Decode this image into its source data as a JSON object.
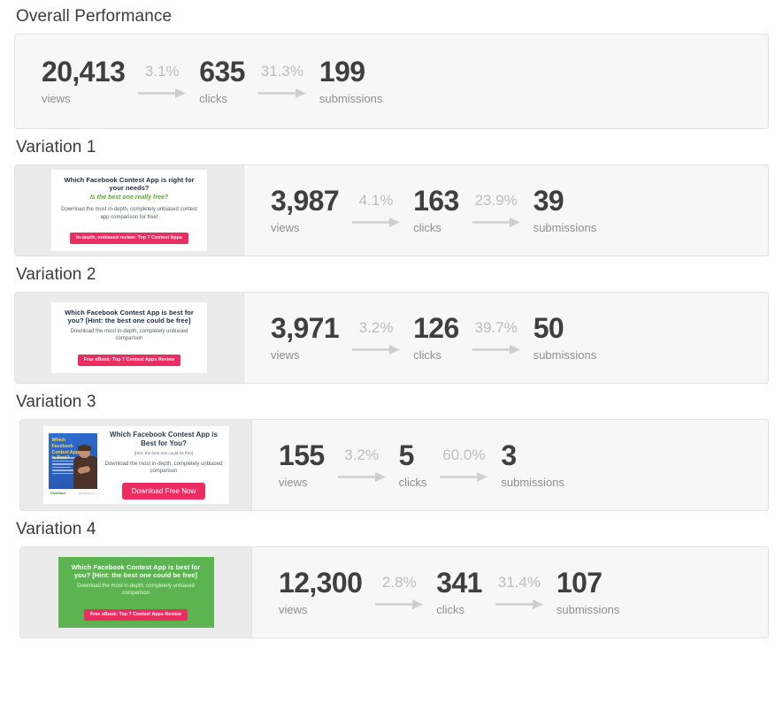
{
  "accent": {
    "cta_pink": "#ec2d62",
    "green_bg": "#5cb450",
    "value_gray": "#3f3f3f",
    "muted_gray": "#bdbdbd"
  },
  "overall": {
    "title": "Overall Performance",
    "views": {
      "value": "20,413",
      "label": "views"
    },
    "rate_views_clicks": "3.1%",
    "clicks": {
      "value": "635",
      "label": "clicks"
    },
    "rate_clicks_subs": "31.3%",
    "submissions": {
      "value": "199",
      "label": "submissions"
    }
  },
  "variations": [
    {
      "title": "Variation 1",
      "views": {
        "value": "3,987",
        "label": "views"
      },
      "rate_views_clicks": "4.1%",
      "clicks": {
        "value": "163",
        "label": "clicks"
      },
      "rate_clicks_subs": "23.9%",
      "submissions": {
        "value": "39",
        "label": "submissions"
      },
      "ad": {
        "style": "white",
        "headline": "Which Facebook Contest App is right for your needs?",
        "subhead": "Is the best one really free?",
        "body": "Download the most in-depth, completely unbiased contest app comparison for free!",
        "button": "In-depth, unbiased review: Top 7 Contest Apps"
      }
    },
    {
      "title": "Variation 2",
      "views": {
        "value": "3,971",
        "label": "views"
      },
      "rate_views_clicks": "3.2%",
      "clicks": {
        "value": "126",
        "label": "clicks"
      },
      "rate_clicks_subs": "39.7%",
      "submissions": {
        "value": "50",
        "label": "submissions"
      },
      "ad": {
        "style": "white",
        "headline": "Which Facebook Contest App is best for you?  [Hint: the best one could be free]",
        "body": "Download the most in-depth, completely unbiased comparison",
        "button": "Free eBook: Top 7 Contest Apps Review"
      }
    },
    {
      "title": "Variation 3",
      "views": {
        "value": "155",
        "label": "views"
      },
      "rate_views_clicks": "3.2%",
      "clicks": {
        "value": "5",
        "label": "clicks"
      },
      "rate_clicks_subs": "60.0%",
      "submissions": {
        "value": "3",
        "label": "submissions"
      },
      "ad": {
        "style": "ebook",
        "cover_title": "Which Facebook Contest App is Best?",
        "cover_logo": "ShortStack",
        "cover_url": "shortstack.com",
        "headline": "Which Facebook Contest App is Best for You?",
        "hint": "[Hint: the best one could be free]",
        "body": "Download the most in-depth, completely unbiased comparison",
        "button": "Download Free Now"
      }
    },
    {
      "title": "Variation 4",
      "views": {
        "value": "12,300",
        "label": "views"
      },
      "rate_views_clicks": "2.8%",
      "clicks": {
        "value": "341",
        "label": "clicks"
      },
      "rate_clicks_subs": "31.4%",
      "submissions": {
        "value": "107",
        "label": "submissions"
      },
      "ad": {
        "style": "green",
        "headline": "Which Facebook Contest App is best for you?  [Hint: the best one could be free]",
        "body": "Download the most in-depth, completely unbiased comparison",
        "button": "Free eBook: Top 7 Contest Apps Review"
      }
    }
  ]
}
